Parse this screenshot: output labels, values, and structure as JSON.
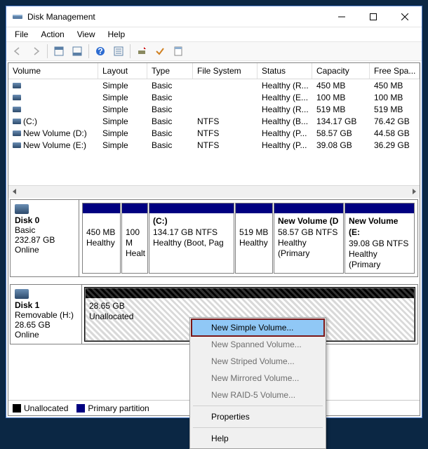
{
  "title": "Disk Management",
  "menu": {
    "file": "File",
    "action": "Action",
    "view": "View",
    "help": "Help"
  },
  "columns": {
    "volume": "Volume",
    "layout": "Layout",
    "type": "Type",
    "fs": "File System",
    "status": "Status",
    "capacity": "Capacity",
    "free": "Free Spa..."
  },
  "rows": [
    {
      "vol": "",
      "layout": "Simple",
      "type": "Basic",
      "fs": "",
      "status": "Healthy (R...",
      "cap": "450 MB",
      "free": "450 MB"
    },
    {
      "vol": "",
      "layout": "Simple",
      "type": "Basic",
      "fs": "",
      "status": "Healthy (E...",
      "cap": "100 MB",
      "free": "100 MB"
    },
    {
      "vol": "",
      "layout": "Simple",
      "type": "Basic",
      "fs": "",
      "status": "Healthy (R...",
      "cap": "519 MB",
      "free": "519 MB"
    },
    {
      "vol": "(C:)",
      "layout": "Simple",
      "type": "Basic",
      "fs": "NTFS",
      "status": "Healthy (B...",
      "cap": "134.17 GB",
      "free": "76.42 GB"
    },
    {
      "vol": "New Volume (D:)",
      "layout": "Simple",
      "type": "Basic",
      "fs": "NTFS",
      "status": "Healthy (P...",
      "cap": "58.57 GB",
      "free": "44.58 GB"
    },
    {
      "vol": "New Volume (E:)",
      "layout": "Simple",
      "type": "Basic",
      "fs": "NTFS",
      "status": "Healthy (P...",
      "cap": "39.08 GB",
      "free": "36.29 GB"
    }
  ],
  "disk0": {
    "name": "Disk 0",
    "type": "Basic",
    "size": "232.87 GB",
    "state": "Online",
    "parts": [
      {
        "title": "",
        "l1": "450 MB",
        "l2": "Healthy"
      },
      {
        "title": "",
        "l1": "100 M",
        "l2": "Healt"
      },
      {
        "title": "(C:)",
        "l1": "134.17 GB NTFS",
        "l2": "Healthy (Boot, Pag"
      },
      {
        "title": "",
        "l1": "519 MB",
        "l2": "Healthy"
      },
      {
        "title": "New Volume  (D",
        "l1": "58.57 GB NTFS",
        "l2": "Healthy (Primary"
      },
      {
        "title": "New Volume  (E:",
        "l1": "39.08 GB NTFS",
        "l2": "Healthy (Primary"
      }
    ]
  },
  "disk1": {
    "name": "Disk 1",
    "type": "Removable (H:)",
    "size": "28.65 GB",
    "state": "Online",
    "part": {
      "l1": "28.65 GB",
      "l2": "Unallocated"
    }
  },
  "legend": {
    "unalloc": "Unallocated",
    "primary": "Primary partition"
  },
  "ctx": {
    "nsv": "New Simple Volume...",
    "nspv": "New Spanned Volume...",
    "nstv": "New Striped Volume...",
    "nmv": "New Mirrored Volume...",
    "nr5v": "New RAID-5 Volume...",
    "prop": "Properties",
    "help": "Help"
  }
}
